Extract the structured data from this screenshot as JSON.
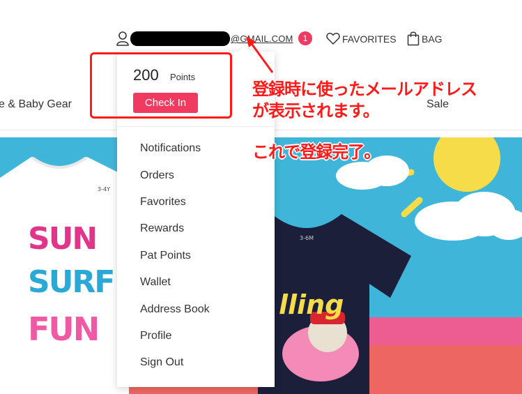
{
  "header": {
    "email_suffix": "@GMAIL.COM",
    "notification_count": "1",
    "favorites_label": "FAVORITES",
    "bag_label": "BAG"
  },
  "nav": {
    "items": [
      {
        "label": "e & Baby Gear"
      },
      {
        "label": "Sale"
      }
    ]
  },
  "dropdown": {
    "points_value": "200",
    "points_label": "Points",
    "check_in_label": "Check In",
    "menu": [
      {
        "label": "Notifications"
      },
      {
        "label": "Orders"
      },
      {
        "label": "Favorites"
      },
      {
        "label": "Rewards"
      },
      {
        "label": "Pat Points"
      },
      {
        "label": "Wallet"
      },
      {
        "label": "Address Book"
      },
      {
        "label": "Profile"
      },
      {
        "label": "Sign Out"
      }
    ]
  },
  "banner": {
    "shirt1_text": [
      "SUN",
      "SURF",
      "FUN"
    ],
    "shirt1_tag": "3-4Y",
    "shirt2_text": "lling",
    "shirt2_tag": "3-6M"
  },
  "annotation": {
    "line1": "登録時に使ったメールアドレス",
    "line2": "が表示されます。",
    "line3": "これで登録完了。"
  },
  "colors": {
    "accent": "#f03a5f",
    "annotation_red": "#ff1a1a",
    "banner_sky": "#3fb6d9",
    "banner_pink": "#ec5d91",
    "banner_coral": "#ee6662",
    "sun_yellow": "#f7dc4a"
  },
  "icons": [
    "user-icon",
    "heart-icon",
    "bag-icon"
  ]
}
